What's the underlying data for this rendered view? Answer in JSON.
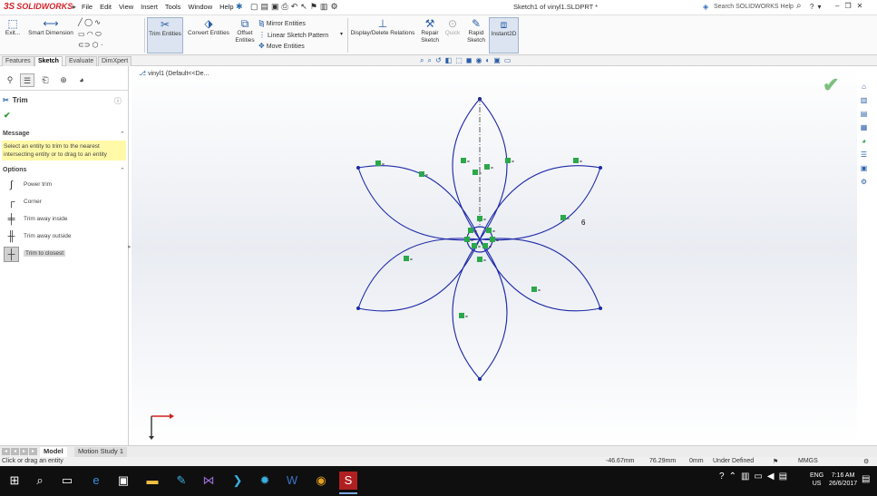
{
  "titlebar": {
    "logo": "SOLIDWORKS",
    "menu": [
      "File",
      "Edit",
      "View",
      "Insert",
      "Tools",
      "Window",
      "Help"
    ],
    "document_title": "Sketch1 of vinyl1.SLDPRT *",
    "search_placeholder": "Search SOLIDWORKS Help"
  },
  "toolbar": {
    "exit_sketch": "Exit...",
    "smart_dimension": "Smart Dimension",
    "trim_entities": "Trim Entities",
    "convert_entities": "Convert Entities",
    "offset_entities_1": "Offset",
    "offset_entities_2": "Entities",
    "mirror_entities": "Mirror Entities",
    "linear_pattern": "Linear Sketch Pattern",
    "move_entities": "Move Entities",
    "display_delete_relations": "Display/Delete Relations",
    "repair_sketch_1": "Repair",
    "repair_sketch_2": "Sketch",
    "quick_snaps": "Quick",
    "rapid_sketch_1": "Rapid",
    "rapid_sketch_2": "Sketch",
    "instant2d": "Instant2D"
  },
  "tabs": [
    "Features",
    "Sketch",
    "Evaluate",
    "DimXpert"
  ],
  "active_tab": "Sketch",
  "panel": {
    "title": "Trim",
    "message_title": "Message",
    "message_text": "Select an entity to trim to the nearest intersecting entity or to drag to an entity",
    "options_title": "Options",
    "options": [
      {
        "label": "Power trim",
        "icon": "power-trim-icon"
      },
      {
        "label": "Corner",
        "icon": "corner-trim-icon"
      },
      {
        "label": "Trim away inside",
        "icon": "trim-inside-icon"
      },
      {
        "label": "Trim away outside",
        "icon": "trim-outside-icon"
      },
      {
        "label": "Trim to closest",
        "icon": "trim-closest-icon"
      }
    ],
    "selected_option": "Trim to closest"
  },
  "graphics": {
    "breadcrumb": "vinyl1 (Default<<De..."
  },
  "sketch": {
    "dimension": "6",
    "relation_marker": "=",
    "line_color": "#1f2aa8",
    "relation_color": "#2aa84a"
  },
  "bottom_tabs": [
    "Model",
    "Motion Study 1"
  ],
  "status": {
    "prompt": "Click or drag an entity",
    "x": "-46.67mm",
    "y": "76.29mm",
    "z": "0mm",
    "state": "Under Defined",
    "units": "MMGS"
  },
  "tray": {
    "lang_1": "ENG",
    "lang_2": "US",
    "time": "7:16 AM",
    "date": "26/6/2017"
  }
}
